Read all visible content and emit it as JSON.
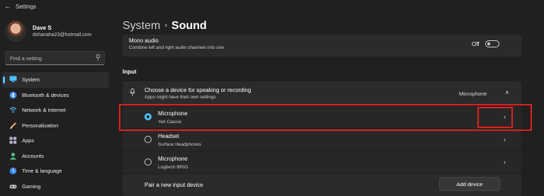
{
  "window": {
    "title": "Settings",
    "back_icon": "back-arrow-icon"
  },
  "user": {
    "name": "Dave S",
    "email": "dshanaha23@hotmail.com"
  },
  "search": {
    "placeholder": "Find a setting",
    "icon": "search-icon"
  },
  "nav": {
    "items": [
      {
        "label": "System",
        "icon": "system-icon",
        "active": true
      },
      {
        "label": "Bluetooth & devices",
        "icon": "bluetooth-icon"
      },
      {
        "label": "Network & internet",
        "icon": "network-icon"
      },
      {
        "label": "Personalization",
        "icon": "personalization-icon"
      },
      {
        "label": "Apps",
        "icon": "apps-icon"
      },
      {
        "label": "Accounts",
        "icon": "accounts-icon"
      },
      {
        "label": "Time & language",
        "icon": "time-language-icon"
      },
      {
        "label": "Gaming",
        "icon": "gaming-icon"
      }
    ]
  },
  "breadcrumb": {
    "parent": "System",
    "separator": "›",
    "current": "Sound"
  },
  "mono_audio": {
    "title": "Mono audio",
    "description": "Combine left and right audio channels into one",
    "toggle_label": "Off",
    "enabled": false
  },
  "input": {
    "heading": "Input",
    "choose": {
      "title": "Choose a device for speaking or recording",
      "description": "Apps might have their own settings",
      "value": "Microphone"
    },
    "devices": [
      {
        "name": "Microphone",
        "description": "Yeti Classic",
        "selected": true
      },
      {
        "name": "Headset",
        "description": "Surface Headphones",
        "selected": false
      },
      {
        "name": "Microphone",
        "description": "Logitech BRIO",
        "selected": false
      }
    ],
    "pair": {
      "label": "Pair a new input device",
      "button": "Add device"
    }
  },
  "colors": {
    "accent": "#4cc2ff",
    "highlight": "#e02020",
    "background": "#202020"
  }
}
